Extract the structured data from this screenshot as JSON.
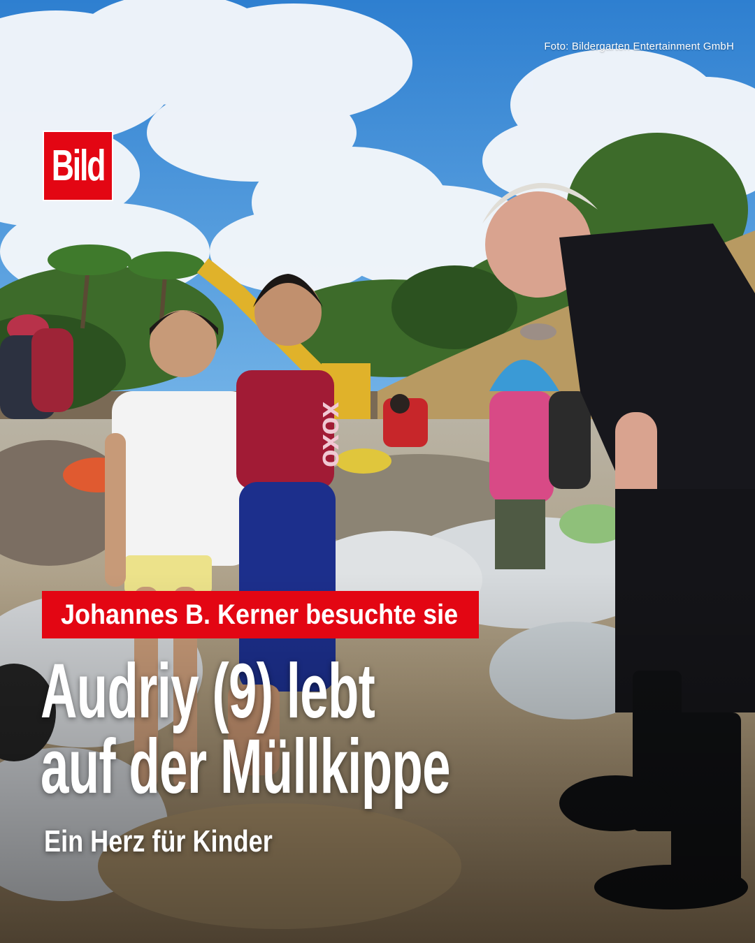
{
  "photo_credit": "Foto: Bildergarten Entertainment GmbH",
  "logo_text": "Bild",
  "kicker": "Johannes B. Kerner besuchte sie",
  "headline": {
    "line1": "Audriy (9) lebt",
    "line2": "auf der Müllkippe"
  },
  "subline": "Ein Herz für Kinder",
  "shirt_text": "XOXO",
  "colors": {
    "brand_red": "#e30613",
    "text": "#ffffff",
    "sky": "#2f86d6"
  }
}
